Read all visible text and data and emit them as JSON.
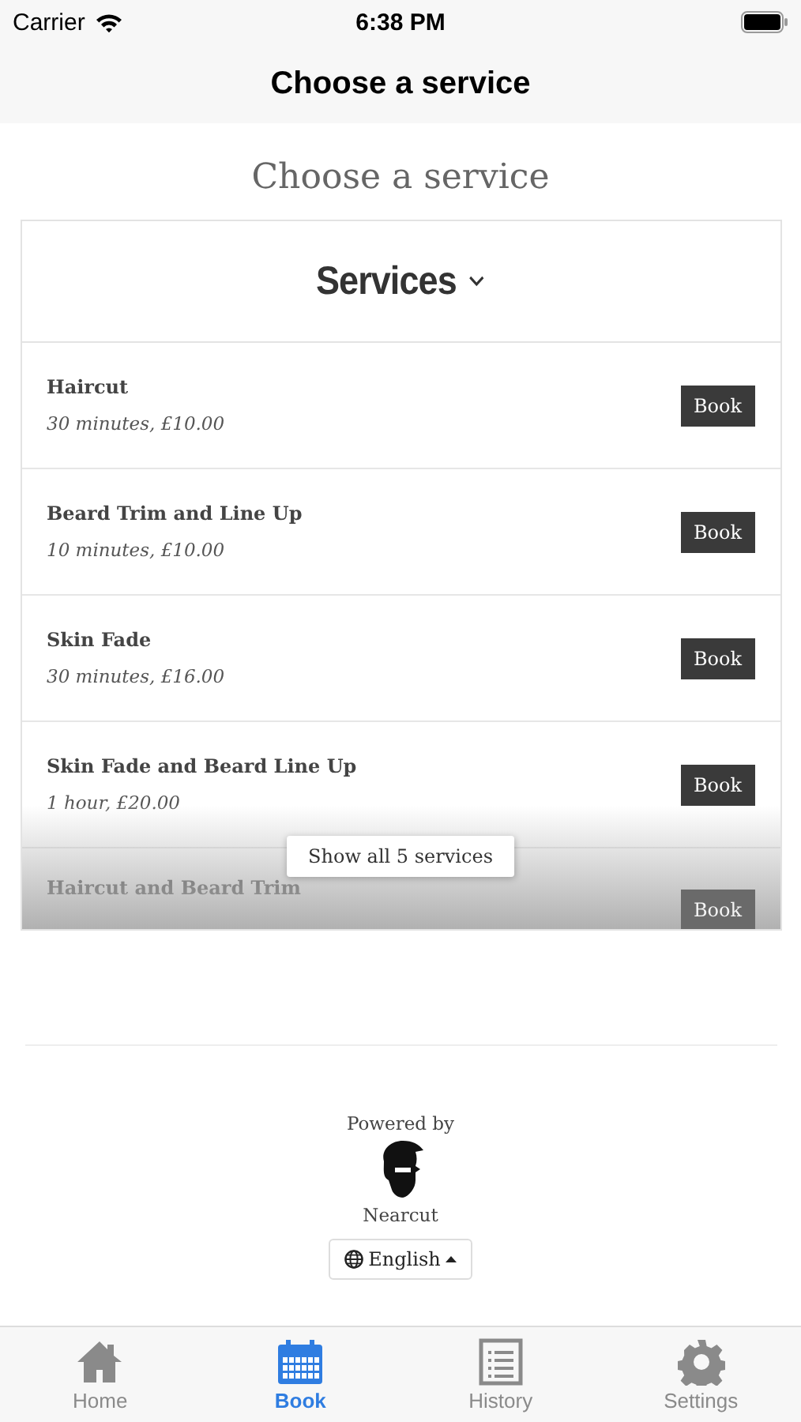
{
  "status_bar": {
    "carrier": "Carrier",
    "time": "6:38 PM"
  },
  "nav_bar": {
    "title": "Choose a service"
  },
  "heading": "Choose a service",
  "services_card": {
    "title": "Services",
    "rows": [
      {
        "name": "Haircut",
        "details": "30 minutes, £10.00",
        "button": "Book"
      },
      {
        "name": "Beard Trim and Line Up",
        "details": "10 minutes, £10.00",
        "button": "Book"
      },
      {
        "name": "Skin Fade",
        "details": "30 minutes, £16.00",
        "button": "Book"
      },
      {
        "name": "Skin Fade and Beard Line Up",
        "details": "1 hour, £20.00",
        "button": "Book"
      },
      {
        "name": "Haircut and Beard Trim",
        "button": "Book"
      }
    ],
    "show_all": "Show all 5 services"
  },
  "footer": {
    "powered_by": "Powered by",
    "brand": "Nearcut",
    "language": "English"
  },
  "tab_bar": [
    {
      "label": "Home",
      "selected": false
    },
    {
      "label": "Book",
      "selected": true
    },
    {
      "label": "History",
      "selected": false
    },
    {
      "label": "Settings",
      "selected": false
    }
  ]
}
